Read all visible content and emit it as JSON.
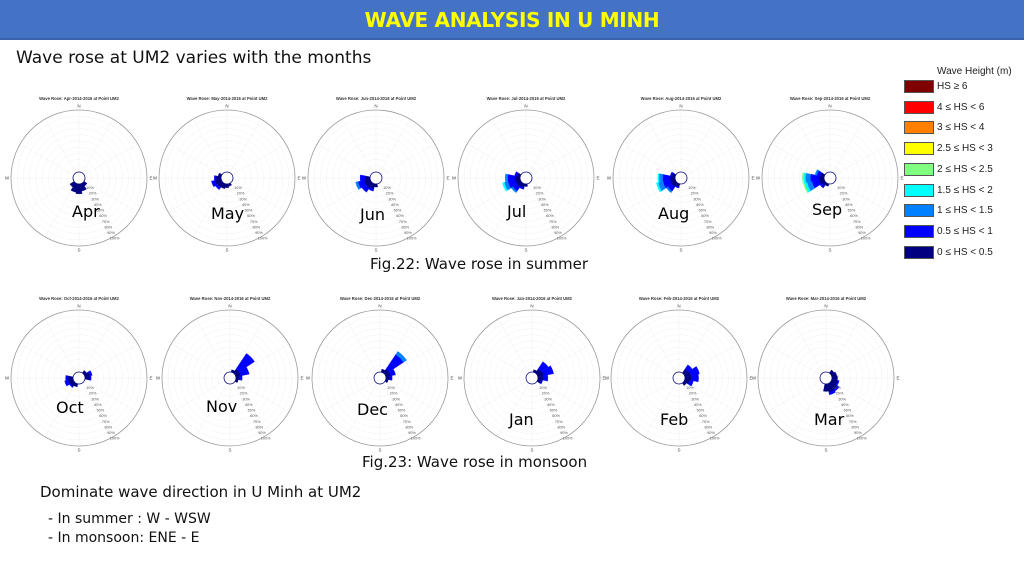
{
  "header": {
    "title": "WAVE ANALYSIS IN U MINH"
  },
  "subtitle": "Wave rose at UM2 varies with the months",
  "captions": {
    "summer": "Fig.22: Wave rose in summer",
    "monsoon": "Fig.23: Wave rose in monsoon"
  },
  "notes": {
    "heading": "Dominate wave direction in U Minh at UM2",
    "lines": [
      "- In summer : W - WSW",
      "- In monsoon: ENE - E"
    ]
  },
  "legend": {
    "title": "Wave Height (m)",
    "items": [
      {
        "label": "HS ≥ 6",
        "color": "#7f0000"
      },
      {
        "label": "4 ≤ HS < 6",
        "color": "#ff0000"
      },
      {
        "label": "3 ≤ HS < 4",
        "color": "#ff8000"
      },
      {
        "label": "2.5 ≤ HS < 3",
        "color": "#ffff00"
      },
      {
        "label": "2 ≤ HS < 2.5",
        "color": "#80ff80"
      },
      {
        "label": "1.5 ≤ HS < 2",
        "color": "#00ffff"
      },
      {
        "label": "1 ≤ HS < 1.5",
        "color": "#0080ff"
      },
      {
        "label": "0.5 ≤ HS < 1",
        "color": "#0000ff"
      },
      {
        "label": "0 ≤ HS < 0.5",
        "color": "#000080"
      }
    ]
  },
  "chart_data": [
    {
      "type": "rose",
      "month": "Apr",
      "title": "Wave Rose: Apr-2014-2016 at Point UM2",
      "season": "summer",
      "compass": [
        "N",
        "E",
        "S",
        "W"
      ],
      "radial_ticks": [
        "10%",
        "20%",
        "30%",
        "40%",
        "50%",
        "60%",
        "70%",
        "80%",
        "90%",
        "100%"
      ],
      "petals": [
        {
          "dir": 180,
          "width": 22.5,
          "bins": [
            16
          ]
        },
        {
          "dir": 202.5,
          "width": 22.5,
          "bins": [
            14
          ]
        },
        {
          "dir": 157.5,
          "width": 22.5,
          "bins": [
            12
          ]
        },
        {
          "dir": 225,
          "width": 22.5,
          "bins": [
            8
          ]
        },
        {
          "dir": 135,
          "width": 22.5,
          "bins": [
            6
          ]
        }
      ]
    },
    {
      "type": "rose",
      "month": "May",
      "title": "Wave Rose: May-2014-2016 at Point UM2",
      "season": "summer",
      "compass": [
        "N",
        "E",
        "S",
        "W"
      ],
      "radial_ticks": [
        "10%",
        "20%",
        "30%",
        "40%",
        "50%",
        "60%",
        "70%",
        "80%",
        "90%",
        "100%"
      ],
      "petals": [
        {
          "dir": 247.5,
          "width": 22.5,
          "bins": [
            10,
            6
          ]
        },
        {
          "dir": 225,
          "width": 22.5,
          "bins": [
            9,
            4
          ]
        },
        {
          "dir": 270,
          "width": 22.5,
          "bins": [
            8,
            3
          ]
        },
        {
          "dir": 202.5,
          "width": 22.5,
          "bins": [
            8
          ]
        },
        {
          "dir": 180,
          "width": 22.5,
          "bins": [
            6
          ]
        },
        {
          "dir": 292.5,
          "width": 22.5,
          "bins": [
            5
          ]
        },
        {
          "dir": 157.5,
          "width": 22.5,
          "bins": [
            4
          ]
        }
      ]
    },
    {
      "type": "rose",
      "month": "Jun",
      "title": "Wave Rose: Jun-2014-2016 at Point UM2",
      "season": "summer",
      "compass": [
        "N",
        "E",
        "S",
        "W"
      ],
      "radial_ticks": [
        "10%",
        "20%",
        "30%",
        "40%",
        "50%",
        "60%",
        "70%",
        "80%",
        "90%",
        "100%"
      ],
      "petals": [
        {
          "dir": 247.5,
          "width": 22.5,
          "bins": [
            10,
            10,
            4
          ]
        },
        {
          "dir": 225,
          "width": 22.5,
          "bins": [
            10,
            8
          ]
        },
        {
          "dir": 270,
          "width": 22.5,
          "bins": [
            8,
            8
          ]
        },
        {
          "dir": 202.5,
          "width": 22.5,
          "bins": [
            8,
            4
          ]
        },
        {
          "dir": 180,
          "width": 22.5,
          "bins": [
            5
          ]
        }
      ]
    },
    {
      "type": "rose",
      "month": "Jul",
      "title": "Wave Rose: Jul-2014-2016 at Point UM2",
      "season": "summer",
      "compass": [
        "N",
        "E",
        "S",
        "W"
      ],
      "radial_ticks": [
        "10%",
        "20%",
        "30%",
        "40%",
        "50%",
        "60%",
        "70%",
        "80%",
        "90%",
        "100%"
      ],
      "petals": [
        {
          "dir": 247.5,
          "width": 22.5,
          "bins": [
            8,
            12,
            6,
            3
          ]
        },
        {
          "dir": 270,
          "width": 22.5,
          "bins": [
            8,
            12,
            4
          ]
        },
        {
          "dir": 225,
          "width": 22.5,
          "bins": [
            8,
            8,
            3
          ]
        },
        {
          "dir": 292.5,
          "width": 22.5,
          "bins": [
            5,
            4
          ]
        },
        {
          "dir": 202.5,
          "width": 22.5,
          "bins": [
            6,
            3
          ]
        },
        {
          "dir": 180,
          "width": 22.5,
          "bins": [
            4
          ]
        }
      ]
    },
    {
      "type": "rose",
      "month": "Aug",
      "title": "Wave Rose: Aug-2014-2016 at Point UM2",
      "season": "summer",
      "compass": [
        "N",
        "E",
        "S",
        "W"
      ],
      "radial_ticks": [
        "10%",
        "20%",
        "30%",
        "40%",
        "50%",
        "60%",
        "70%",
        "80%",
        "90%",
        "100%"
      ],
      "petals": [
        {
          "dir": 247.5,
          "width": 22.5,
          "bins": [
            8,
            12,
            8,
            3
          ]
        },
        {
          "dir": 270,
          "width": 22.5,
          "bins": [
            8,
            12,
            6,
            2
          ]
        },
        {
          "dir": 225,
          "width": 22.5,
          "bins": [
            8,
            8,
            3
          ]
        },
        {
          "dir": 292.5,
          "width": 22.5,
          "bins": [
            5,
            3
          ]
        },
        {
          "dir": 202.5,
          "width": 22.5,
          "bins": [
            5,
            2
          ]
        }
      ]
    },
    {
      "type": "rose",
      "month": "Sep",
      "title": "Wave Rose: Sep-2014-2016 at Point UM2",
      "season": "summer",
      "compass": [
        "N",
        "E",
        "S",
        "W"
      ],
      "radial_ticks": [
        "10%",
        "20%",
        "30%",
        "40%",
        "50%",
        "60%",
        "70%",
        "80%",
        "90%",
        "100%"
      ],
      "petals": [
        {
          "dir": 270,
          "width": 22.5,
          "bins": [
            8,
            14,
            8,
            3,
            2
          ]
        },
        {
          "dir": 247.5,
          "width": 22.5,
          "bins": [
            8,
            12,
            8,
            4,
            2
          ]
        },
        {
          "dir": 292.5,
          "width": 22.5,
          "bins": [
            6,
            6,
            3
          ]
        },
        {
          "dir": 225,
          "width": 22.5,
          "bins": [
            6,
            4
          ]
        },
        {
          "dir": 202.5,
          "width": 22.5,
          "bins": [
            4
          ]
        }
      ]
    },
    {
      "type": "rose",
      "month": "Oct",
      "title": "Wave Rose: Oct-2014-2016 at Point UM2",
      "season": "monsoon",
      "compass": [
        "N",
        "E",
        "S",
        "W"
      ],
      "radial_ticks": [
        "10%",
        "20%",
        "30%",
        "40%",
        "50%",
        "60%",
        "70%",
        "80%",
        "90%",
        "100%"
      ],
      "petals": [
        {
          "dir": 247.5,
          "width": 22.5,
          "bins": [
            8,
            6
          ]
        },
        {
          "dir": 270,
          "width": 22.5,
          "bins": [
            8,
            4
          ]
        },
        {
          "dir": 67.5,
          "width": 22.5,
          "bins": [
            8,
            4
          ]
        },
        {
          "dir": 90,
          "width": 22.5,
          "bins": [
            8,
            2
          ]
        },
        {
          "dir": 225,
          "width": 22.5,
          "bins": [
            7,
            2
          ]
        },
        {
          "dir": 45,
          "width": 22.5,
          "bins": [
            5
          ]
        },
        {
          "dir": 202.5,
          "width": 22.5,
          "bins": [
            5
          ]
        }
      ]
    },
    {
      "type": "rose",
      "month": "Nov",
      "title": "Wave Rose: Nov-2014-2016 at Point UM2",
      "season": "monsoon",
      "compass": [
        "N",
        "E",
        "S",
        "W"
      ],
      "radial_ticks": [
        "10%",
        "20%",
        "30%",
        "40%",
        "50%",
        "60%",
        "70%",
        "80%",
        "90%",
        "100%"
      ],
      "petals": [
        {
          "dir": 45,
          "width": 22.5,
          "bins": [
            8,
            30
          ]
        },
        {
          "dir": 67.5,
          "width": 22.5,
          "bins": [
            8,
            14
          ]
        },
        {
          "dir": 90,
          "width": 22.5,
          "bins": [
            6,
            4
          ]
        },
        {
          "dir": 112.5,
          "width": 22.5,
          "bins": [
            4
          ]
        },
        {
          "dir": 22.5,
          "width": 22.5,
          "bins": [
            4
          ]
        }
      ]
    },
    {
      "type": "rose",
      "month": "Dec",
      "title": "Wave Rose: Dec-2014-2016 at Point UM2",
      "season": "monsoon",
      "compass": [
        "N",
        "E",
        "S",
        "W"
      ],
      "radial_ticks": [
        "10%",
        "20%",
        "30%",
        "40%",
        "50%",
        "60%",
        "70%",
        "80%",
        "90%",
        "100%"
      ],
      "petals": [
        {
          "dir": 45,
          "width": 22.5,
          "bins": [
            8,
            28,
            6
          ]
        },
        {
          "dir": 67.5,
          "width": 22.5,
          "bins": [
            8,
            8
          ]
        },
        {
          "dir": 90,
          "width": 22.5,
          "bins": [
            6,
            4
          ]
        },
        {
          "dir": 22.5,
          "width": 22.5,
          "bins": [
            5
          ]
        },
        {
          "dir": 112.5,
          "width": 22.5,
          "bins": [
            4
          ]
        }
      ]
    },
    {
      "type": "rose",
      "month": "Jan",
      "title": "Wave Rose: Jan-2014-2016 at Point UM2",
      "season": "monsoon",
      "compass": [
        "N",
        "E",
        "S",
        "W"
      ],
      "radial_ticks": [
        "10%",
        "20%",
        "30%",
        "40%",
        "50%",
        "60%",
        "70%",
        "80%",
        "90%",
        "100%"
      ],
      "petals": [
        {
          "dir": 45,
          "width": 22.5,
          "bins": [
            8,
            14
          ]
        },
        {
          "dir": 67.5,
          "width": 22.5,
          "bins": [
            10,
            16
          ]
        },
        {
          "dir": 90,
          "width": 22.5,
          "bins": [
            8,
            8
          ]
        },
        {
          "dir": 112.5,
          "width": 22.5,
          "bins": [
            6,
            2
          ]
        },
        {
          "dir": 22.5,
          "width": 22.5,
          "bins": [
            4
          ]
        }
      ]
    },
    {
      "type": "rose",
      "month": "Feb",
      "title": "Wave Rose: Feb-2014-2016 at Point UM2",
      "season": "monsoon",
      "compass": [
        "N",
        "E",
        "S",
        "W"
      ],
      "radial_ticks": [
        "10%",
        "20%",
        "30%",
        "40%",
        "50%",
        "60%",
        "70%",
        "80%",
        "90%",
        "100%"
      ],
      "petals": [
        {
          "dir": 67.5,
          "width": 22.5,
          "bins": [
            10,
            14
          ]
        },
        {
          "dir": 90,
          "width": 22.5,
          "bins": [
            10,
            12
          ]
        },
        {
          "dir": 45,
          "width": 22.5,
          "bins": [
            8,
            8
          ]
        },
        {
          "dir": 112.5,
          "width": 22.5,
          "bins": [
            8,
            6
          ]
        },
        {
          "dir": 135,
          "width": 22.5,
          "bins": [
            5
          ]
        }
      ]
    },
    {
      "type": "rose",
      "month": "Mar",
      "title": "Wave Rose: Mar-2014-2016 at Point UM2",
      "season": "monsoon",
      "compass": [
        "N",
        "E",
        "S",
        "W"
      ],
      "radial_ticks": [
        "10%",
        "20%",
        "30%",
        "40%",
        "50%",
        "60%",
        "70%",
        "80%",
        "90%",
        "100%"
      ],
      "petals": [
        {
          "dir": 157.5,
          "width": 22.5,
          "bins": [
            14,
            4
          ]
        },
        {
          "dir": 135,
          "width": 22.5,
          "bins": [
            12,
            4
          ]
        },
        {
          "dir": 180,
          "width": 22.5,
          "bins": [
            12
          ]
        },
        {
          "dir": 112.5,
          "width": 22.5,
          "bins": [
            10,
            2
          ]
        },
        {
          "dir": 90,
          "width": 22.5,
          "bins": [
            9
          ]
        },
        {
          "dir": 67.5,
          "width": 22.5,
          "bins": [
            8
          ]
        },
        {
          "dir": 45,
          "width": 22.5,
          "bins": [
            6
          ]
        }
      ]
    }
  ]
}
